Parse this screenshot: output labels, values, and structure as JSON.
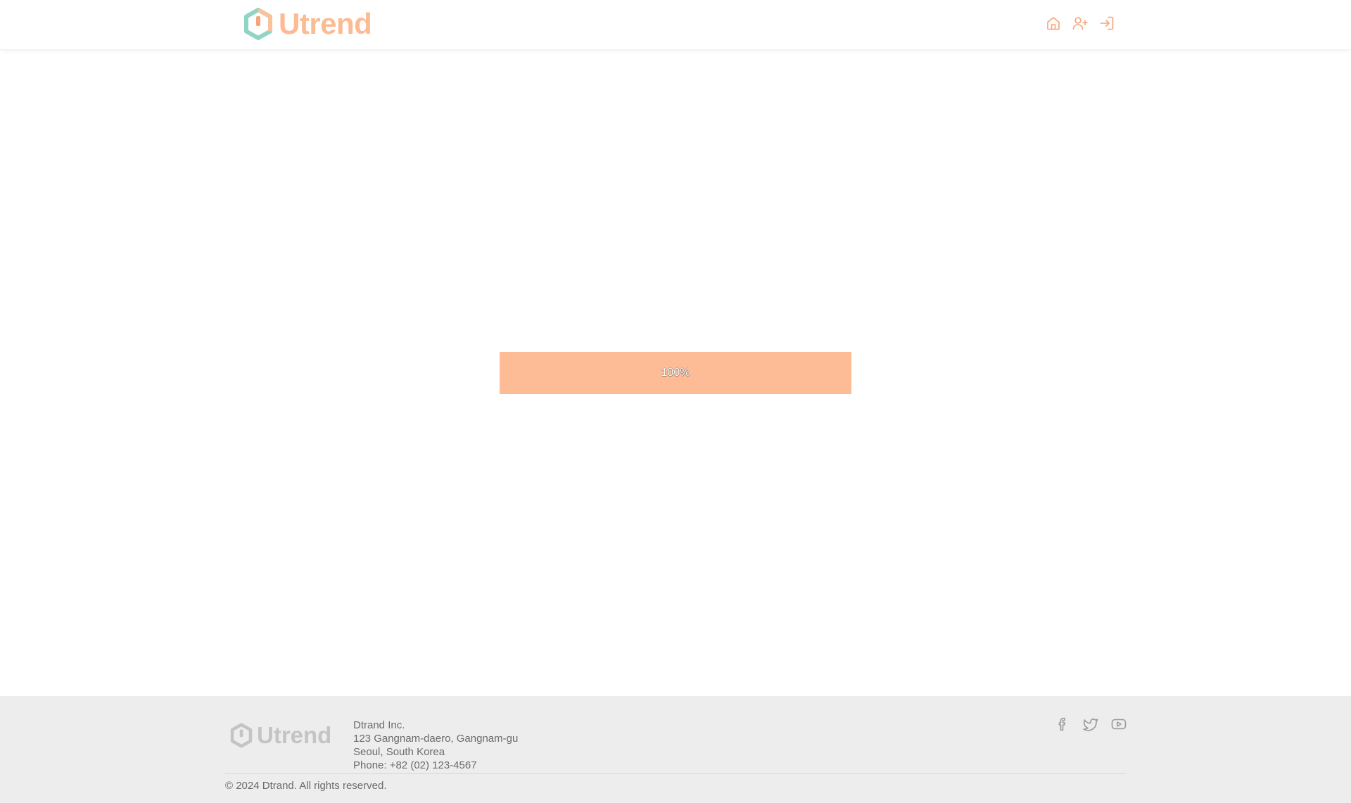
{
  "header": {
    "brand": "Utrend",
    "nav": [
      {
        "icon": "home-icon",
        "label": "Home"
      },
      {
        "icon": "user-plus-icon",
        "label": "Sign up"
      },
      {
        "icon": "log-in-icon",
        "label": "Log in"
      }
    ]
  },
  "main": {
    "progress": {
      "value": 100,
      "label": "100%"
    }
  },
  "footer": {
    "brand": "Utrend",
    "company": {
      "name": "Dtrand Inc.",
      "address_line1": "123 Gangnam-daero, Gangnam-gu",
      "address_line2": "Seoul, South Korea",
      "phone": "Phone: +82 (02) 123-4567"
    },
    "social": [
      "facebook-icon",
      "twitter-icon",
      "youtube-icon"
    ],
    "copyright": "© 2024 Dtrand. All rights reserved."
  },
  "colors": {
    "accent": "#fcbb92",
    "logo_teal": "#8fd4c4",
    "icon_orange": "#f7a277",
    "footer_bg": "#ededed",
    "footer_text": "#6b6b6b"
  }
}
